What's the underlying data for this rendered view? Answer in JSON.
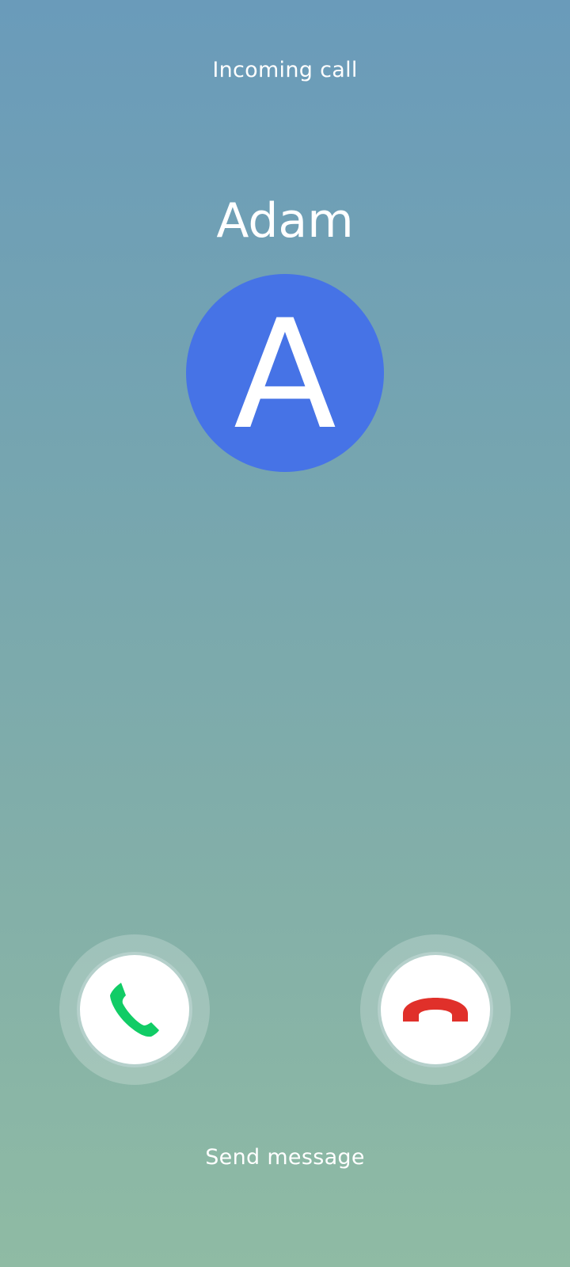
{
  "call": {
    "status": "Incoming call",
    "caller_name": "Adam",
    "avatar_initial": "A",
    "avatar_color": "#4673e6"
  },
  "actions": {
    "accept_icon": "phone-answer-icon",
    "accept_color": "#11cc66",
    "decline_icon": "phone-hangup-icon",
    "decline_color": "#e0302a",
    "send_message_label": "Send message"
  }
}
